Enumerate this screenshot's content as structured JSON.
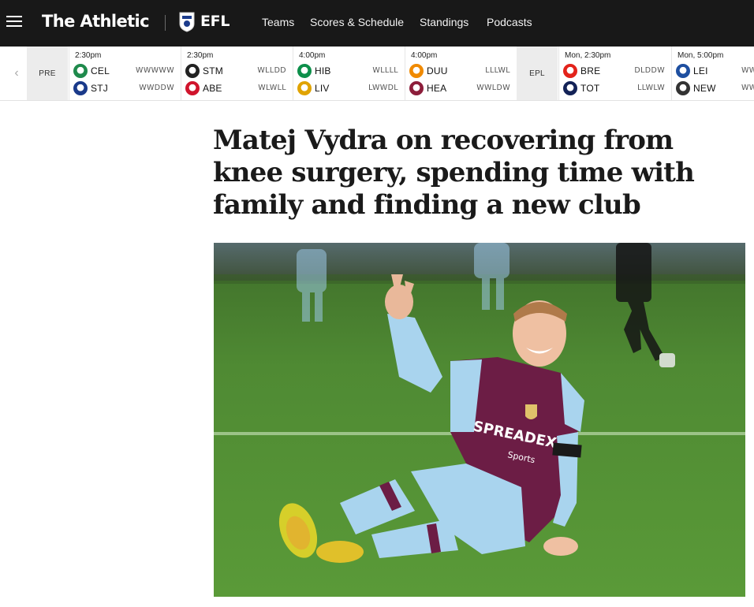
{
  "nav": {
    "brand": "The Athletic",
    "section": "EFL",
    "links": [
      "Teams",
      "Scores & Schedule",
      "Standings",
      "Podcasts"
    ]
  },
  "scores": {
    "leagues": [
      "PRE",
      "EPL"
    ],
    "games": [
      {
        "time": "2:30pm",
        "home": {
          "abbr": "CEL",
          "form": "WWWWW",
          "color": "#1f8a4c"
        },
        "away": {
          "abbr": "STJ",
          "form": "WWDDW",
          "color": "#1a3a8a"
        }
      },
      {
        "time": "2:30pm",
        "home": {
          "abbr": "STM",
          "form": "WLLDD",
          "color": "#222222"
        },
        "away": {
          "abbr": "ABE",
          "form": "WLWLL",
          "color": "#d0142c"
        }
      },
      {
        "time": "4:00pm",
        "home": {
          "abbr": "HIB",
          "form": "WLLLL",
          "color": "#0d8f4a"
        },
        "away": {
          "abbr": "LIV",
          "form": "LWWDL",
          "color": "#e0a300"
        }
      },
      {
        "time": "4:00pm",
        "home": {
          "abbr": "DUU",
          "form": "LLLWL",
          "color": "#f08a00"
        },
        "away": {
          "abbr": "HEA",
          "form": "WWLDW",
          "color": "#8c1d3a"
        }
      },
      {
        "time": "Mon, 2:30pm",
        "home": {
          "abbr": "BRE",
          "form": "DLDDW",
          "color": "#e3231b"
        },
        "away": {
          "abbr": "TOT",
          "form": "LLWLW",
          "color": "#132257"
        }
      },
      {
        "time": "Mon, 5:00pm",
        "home": {
          "abbr": "LEI",
          "form": "WW",
          "color": "#1e4fa0"
        },
        "away": {
          "abbr": "NEW",
          "form": "WW",
          "color": "#333333"
        }
      }
    ]
  },
  "article": {
    "headline": "Matej Vydra on recovering from knee surgery, spending time with family and finding a new club",
    "shirt_sponsor": "SPREADEX",
    "shirt_sponsor_sub": "Sports"
  }
}
